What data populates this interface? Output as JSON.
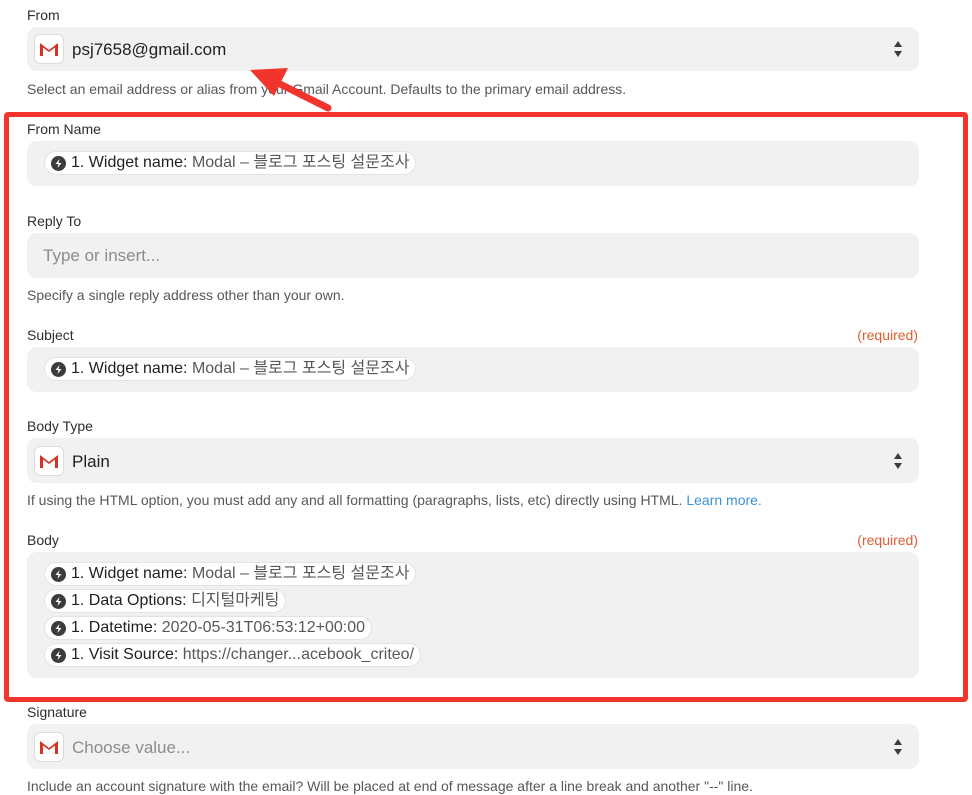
{
  "from": {
    "label": "From",
    "value": "psj7658@gmail.com",
    "hint": "Select an email address or alias from your Gmail Account. Defaults to the primary email address."
  },
  "from_name": {
    "label": "From Name",
    "token": {
      "key": "1. Widget name:",
      "value": "Modal – 블로그 포스팅 설문조사"
    }
  },
  "reply_to": {
    "label": "Reply To",
    "placeholder": "Type or insert...",
    "hint": "Specify a single reply address other than your own."
  },
  "subject": {
    "label": "Subject",
    "required": "(required)",
    "token": {
      "key": "1. Widget name:",
      "value": "Modal – 블로그 포스팅 설문조사"
    }
  },
  "body_type": {
    "label": "Body Type",
    "value": "Plain",
    "hint": "If using the HTML option, you must add any and all formatting (paragraphs, lists, etc) directly using HTML.",
    "link": "Learn more."
  },
  "body": {
    "label": "Body",
    "required": "(required)",
    "tokens": [
      {
        "key": "1. Widget name:",
        "value": "Modal – 블로그 포스팅 설문조사"
      },
      {
        "key": "1. Data Options:",
        "value": "디지털마케팅"
      },
      {
        "key": "1. Datetime:",
        "value": "2020-05-31T06:53:12+00:00"
      },
      {
        "key": "1. Visit Source:",
        "value": "https://changer...acebook_criteo/"
      }
    ]
  },
  "signature": {
    "label": "Signature",
    "placeholder": "Choose value...",
    "hint": "Include an account signature with the email? Will be placed at end of message after a line break and another \"--\" line."
  },
  "colors": {
    "accent_red": "#f2352c",
    "required": "#e25d2f",
    "link": "#3d91d8"
  }
}
